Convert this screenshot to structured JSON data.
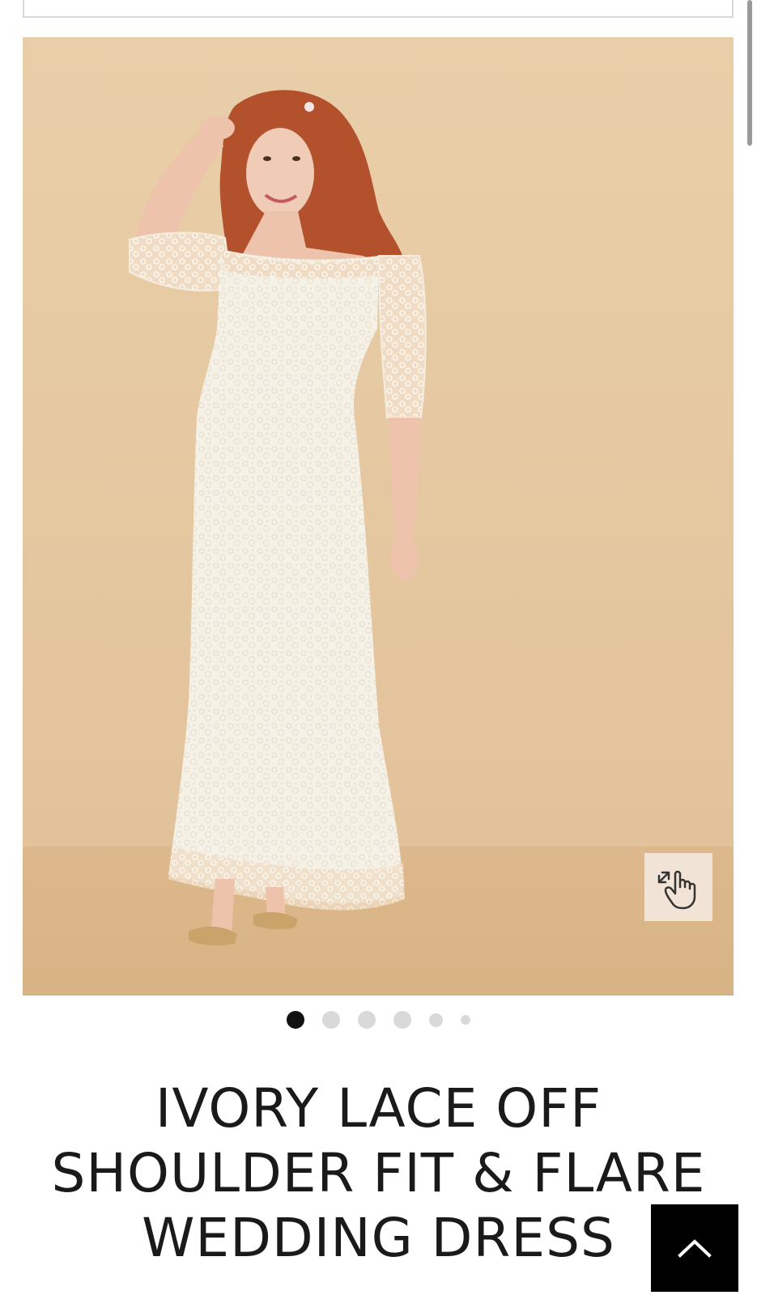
{
  "product": {
    "title": "IVORY LACE OFF SHOULDER FIT & FLARE WEDDING DRESS",
    "image": {
      "subject": "model-wearing-ivory-lace-dress",
      "zoom_icon": "pinch-zoom-hand-icon"
    }
  },
  "carousel": {
    "total_dots": 6,
    "active_index": 0
  },
  "back_to_top": {
    "icon": "chevron-up-icon"
  },
  "colors": {
    "backdrop": "#e6c9a2",
    "floor": "#dbb78e",
    "dress": "#f5f0e4",
    "dot_active": "#111111",
    "dot_inactive": "#d9d9d9",
    "back_to_top_bg": "#000000"
  }
}
